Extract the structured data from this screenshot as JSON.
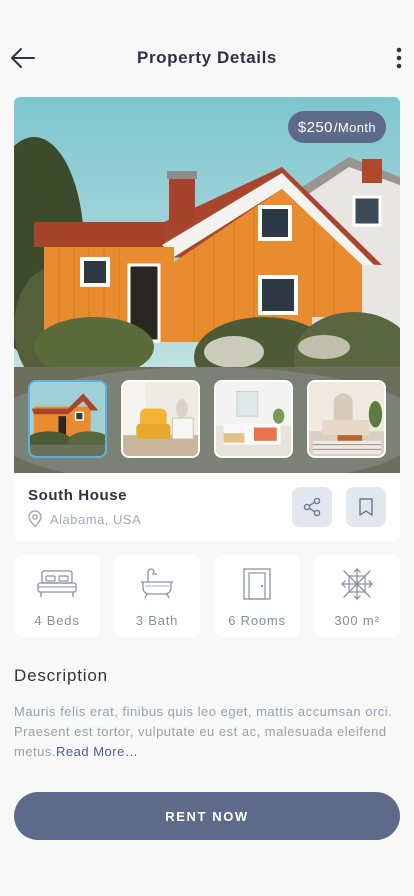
{
  "header": {
    "title": "Property Details",
    "back_icon": "arrow-left-icon",
    "menu_icon": "more-vertical-icon"
  },
  "property": {
    "price_amount": "$250",
    "price_period": "/Month",
    "name": "South House",
    "location": "Alabama, USA",
    "location_icon": "map-pin-icon",
    "share_icon": "share-icon",
    "bookmark_icon": "bookmark-icon"
  },
  "gallery": [
    {
      "name": "exterior",
      "active": true
    },
    {
      "name": "armchair-room",
      "active": false
    },
    {
      "name": "bedroom",
      "active": false
    },
    {
      "name": "living-room",
      "active": false
    }
  ],
  "features": [
    {
      "label": "4 Beds",
      "icon": "bed-icon"
    },
    {
      "label": "3 Bath",
      "icon": "bathtub-icon"
    },
    {
      "label": "6 Rooms",
      "icon": "door-icon"
    },
    {
      "label": "300 m²",
      "icon": "area-icon"
    }
  ],
  "description": {
    "title": "Description",
    "text": "Mauris felis erat, finibus quis leo eget, mattis accumsan orci. Praesent est tortor, vulputate eu est ac, malesuada eleifend metus.",
    "read_more": "Read More…"
  },
  "cta": {
    "label": "RENT NOW"
  },
  "colors": {
    "accent": "#5e6a89",
    "icon_bg": "#e2e6ef",
    "active_thumb_border": "#5fb0d9",
    "background": "#f8f8f9"
  }
}
